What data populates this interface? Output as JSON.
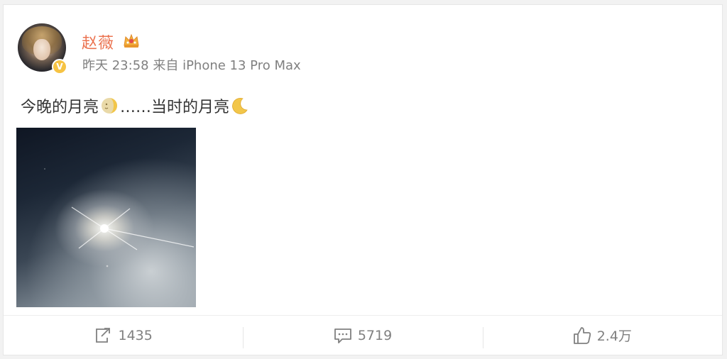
{
  "post": {
    "author": "赵薇",
    "time": "昨天 23:58",
    "source_prefix": "来自",
    "source": "iPhone 13 Pro Max",
    "text_part1": "今晚的月亮",
    "text_part2": "……当时的月亮",
    "verified_mark": "V",
    "crown_icon": "crown-icon",
    "moon_icon_1": "waxing-moon-face-icon",
    "moon_icon_2": "crescent-moon-icon"
  },
  "actions": {
    "repost_count": "1435",
    "comment_count": "5719",
    "like_count": "2.4万"
  },
  "colors": {
    "author": "#eb7350",
    "meta": "#808080",
    "text": "#333333",
    "badge": "#f6c343"
  }
}
